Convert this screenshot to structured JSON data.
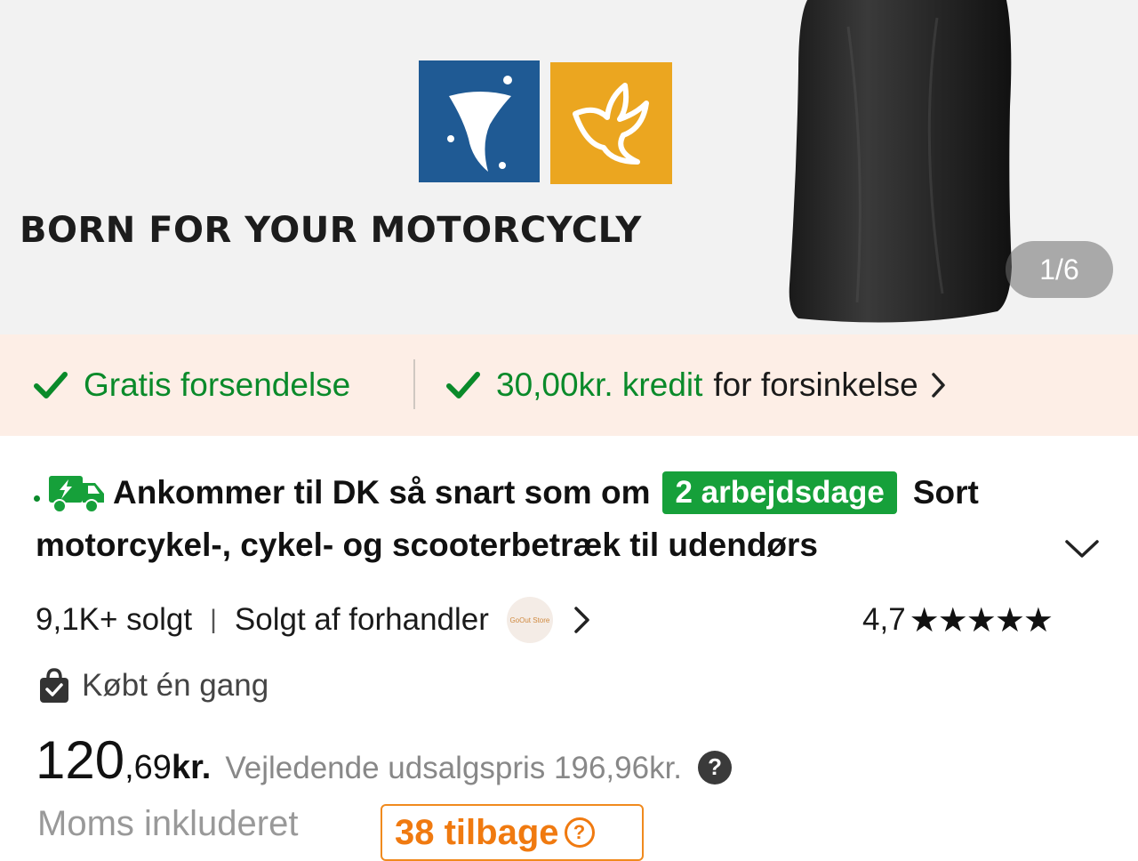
{
  "gallery": {
    "banner_text": "BORN FOR YOUR MOTORCYCLY",
    "counter": "1/6"
  },
  "shipping": {
    "free_shipping": "Gratis forsendelse",
    "credit_amount": "30,00kr. kredit",
    "credit_suffix": "for forsinkelse"
  },
  "title": {
    "arrival_prefix": "Ankommer til DK så snart som om",
    "arrival_badge": "2 arbejdsdage",
    "first_word": "Sort",
    "second_line": "motorcykel-, cykel- og scooterbetræk til udendørs"
  },
  "meta": {
    "sold": "9,1K+ solgt",
    "separator": "|",
    "seller": "Solgt af forhandler",
    "store_name": "GoOut Store",
    "rating": "4,7",
    "stars": "★★★★★"
  },
  "bought": {
    "label": "Købt én gang"
  },
  "price": {
    "main": "120",
    "decimals": ",69",
    "currency": "kr.",
    "rrp_label": "Vejledende udsalgspris 196,96kr.",
    "help": "?",
    "vat": "Moms inkluderet",
    "back_label": "38 tilbage",
    "back_help": "?"
  },
  "colors": {
    "green": "#0a8a2a",
    "badge_green": "#16a03a",
    "orange": "#f07a10",
    "strip_bg": "#fdeee6"
  }
}
